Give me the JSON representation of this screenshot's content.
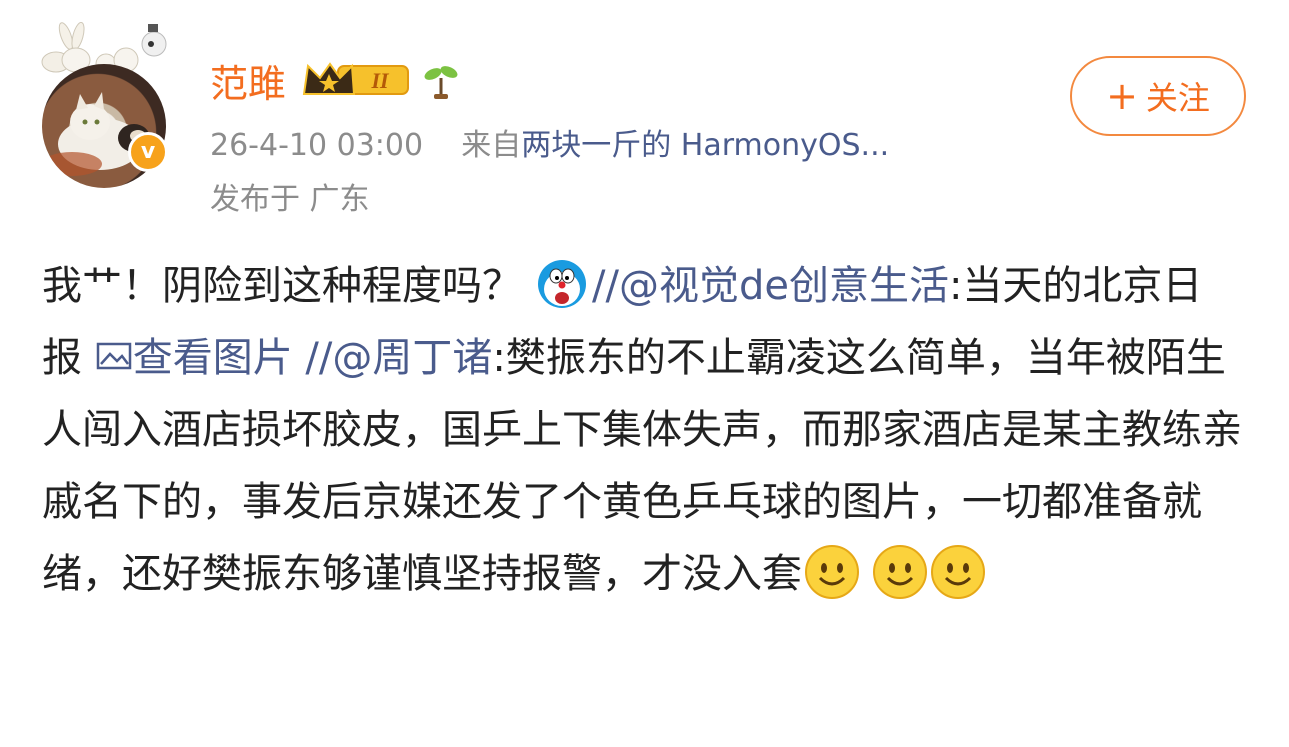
{
  "header": {
    "username": "范雎",
    "badge_level": "II",
    "timestamp": "26-4-10 03:00",
    "source_prefix": "来自",
    "source_device": "两块一斤的 HarmonyOS...",
    "location": "发布于 广东",
    "follow_label": "关注",
    "follow_plus": "+",
    "verified_mark": "v"
  },
  "post": {
    "seg1": "我艹！阴险到这种程度吗？",
    "seg2": "//",
    "mention1": "@视觉de创意生活",
    "seg3": ":当天的北京日报",
    "view_image_label": "查看图片",
    "seg4": " //",
    "mention2": "@周丁诸",
    "seg5": ":樊振东的不止霸凌这么简单，当年被陌生人闯入酒店损坏胶皮，国乒上下集体失声，而那家酒店是某主教练亲戚名下的，事发后京媒还发了个黄色乒乓球的图片，一切都准备就绪，还好樊振东够谨慎坚持报警，才没入套"
  },
  "icons": {
    "verified": "verified-v-icon",
    "crown": "crown-level-icon",
    "sprout": "sprout-icon",
    "doraemon": "doraemon-emoji",
    "smile": "smile-emoji",
    "image": "image-icon"
  },
  "colors": {
    "username": "#f36d1f",
    "link": "#4a5b8c",
    "meta": "#8c8c8c",
    "follow_border": "#f3893f",
    "verified": "#f7a21b"
  }
}
